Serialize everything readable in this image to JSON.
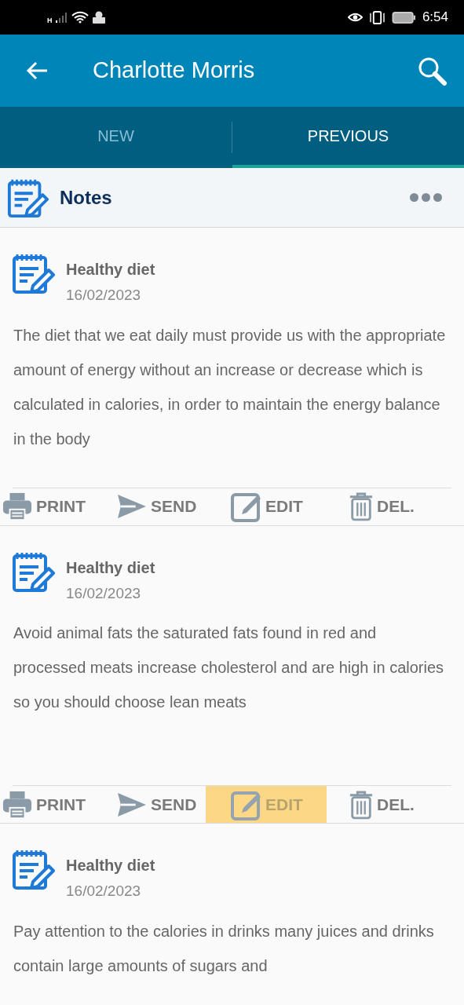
{
  "status_bar": {
    "time": "6:54",
    "network": "H"
  },
  "app_bar": {
    "title": "Charlotte Morris"
  },
  "tabs": [
    {
      "label": "NEW",
      "selected": false
    },
    {
      "label": "PREVIOUS",
      "selected": true
    }
  ],
  "section": {
    "title": "Notes"
  },
  "notes": [
    {
      "title": "Healthy diet",
      "date": "16/02/2023",
      "body": "The diet that we eat daily must provide us with the appropriate amount of energy without an increase or decrease which is calculated in calories, in order to maintain the energy balance in the body",
      "actions": [
        {
          "kind": "print",
          "label": "PRINT",
          "highlighted": false
        },
        {
          "kind": "send",
          "label": "SEND",
          "highlighted": false
        },
        {
          "kind": "edit",
          "label": "EDIT",
          "highlighted": false
        },
        {
          "kind": "delete",
          "label": "DEL.",
          "highlighted": false
        }
      ]
    },
    {
      "title": "Healthy diet",
      "date": "16/02/2023",
      "body": "Avoid animal fats the saturated fats found in red and processed meats increase cholesterol and are high in calories so you should choose lean meats",
      "actions": [
        {
          "kind": "print",
          "label": "PRINT",
          "highlighted": false
        },
        {
          "kind": "send",
          "label": "SEND",
          "highlighted": false
        },
        {
          "kind": "edit",
          "label": "EDIT",
          "highlighted": true
        },
        {
          "kind": "delete",
          "label": "DEL.",
          "highlighted": false
        }
      ]
    },
    {
      "title": "Healthy diet",
      "date": "16/02/2023",
      "body": "Pay attention to the calories in drinks many juices and drinks contain large amounts of sugars and"
    }
  ]
}
